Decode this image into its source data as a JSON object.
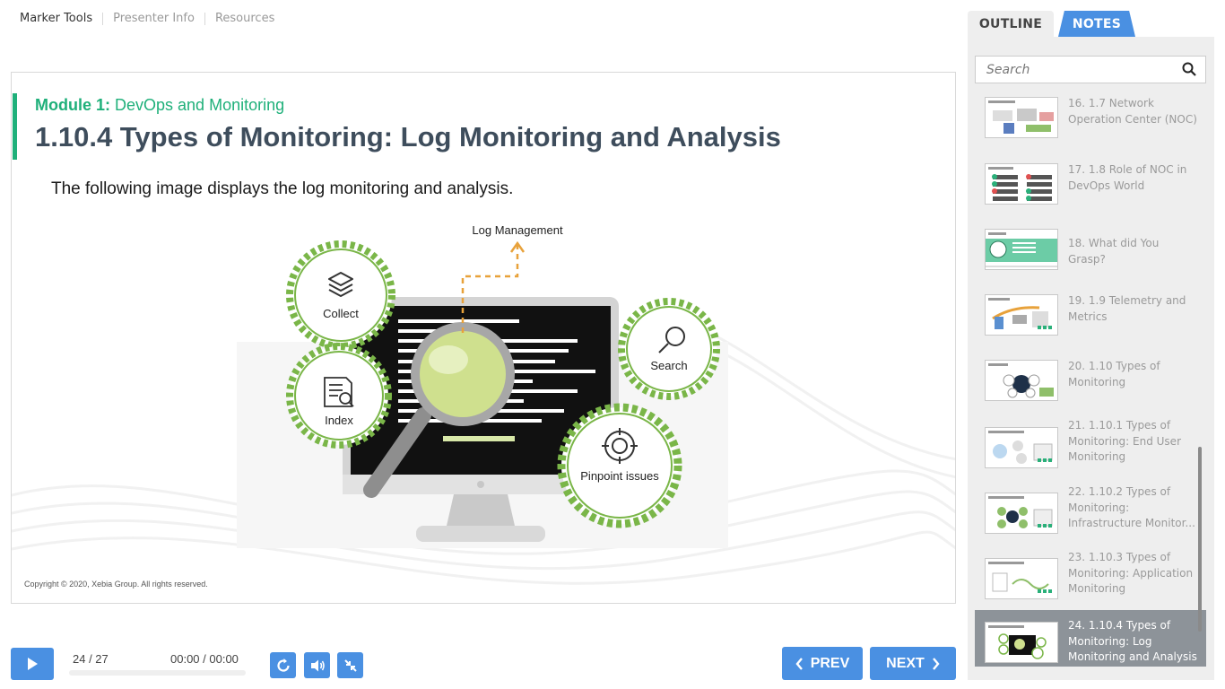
{
  "top_links": [
    {
      "label": "Marker Tools"
    },
    {
      "label": "Presenter Info"
    },
    {
      "label": "Resources"
    }
  ],
  "slide": {
    "module_prefix": "Module 1:",
    "module_name": "DevOps and Monitoring",
    "title": "1.10.4 Types of Monitoring: Log Monitoring and Analysis",
    "body": "The following image displays the log monitoring and analysis.",
    "copyright": "Copyright © 2020, Xebia Group. All rights reserved.",
    "diagram": {
      "top_label": "Log Management",
      "gears": [
        "Collect",
        "Index",
        "Search",
        "Pinpoint issues"
      ]
    }
  },
  "player": {
    "page": "24 / 27",
    "time": "00:00 / 00:00",
    "prev_label": "PREV",
    "next_label": "NEXT"
  },
  "sidebar": {
    "tab_outline": "OUTLINE",
    "tab_notes": "NOTES",
    "search_placeholder": "Search",
    "items": [
      {
        "label": "16. 1.7 Network Operation Center (NOC)"
      },
      {
        "label": "17. 1.8 Role of NOC in DevOps World"
      },
      {
        "label": "18. What did You Grasp?"
      },
      {
        "label": "19. 1.9 Telemetry and Metrics"
      },
      {
        "label": "20. 1.10 Types of Monitoring"
      },
      {
        "label": "21. 1.10.1 Types of Monitoring: End User Monitoring"
      },
      {
        "line1": "22. 1.10.2 Types of",
        "line2": "Monitoring:",
        "line3": "Infrastructure Monitor..."
      },
      {
        "label": "23. 1.10.3 Types of Monitoring: Application Monitoring"
      },
      {
        "label": "24. 1.10.4 Types of Monitoring: Log Monitoring and Analysis"
      }
    ]
  },
  "colors": {
    "accent_green": "#1fb07a",
    "brand_blue": "#4a90e2",
    "gear_green": "#7ab648"
  },
  "icons": [
    "play-icon",
    "replay-icon",
    "volume-icon",
    "collapse-icon",
    "chevron-left-icon",
    "chevron-right-icon",
    "search-icon"
  ]
}
